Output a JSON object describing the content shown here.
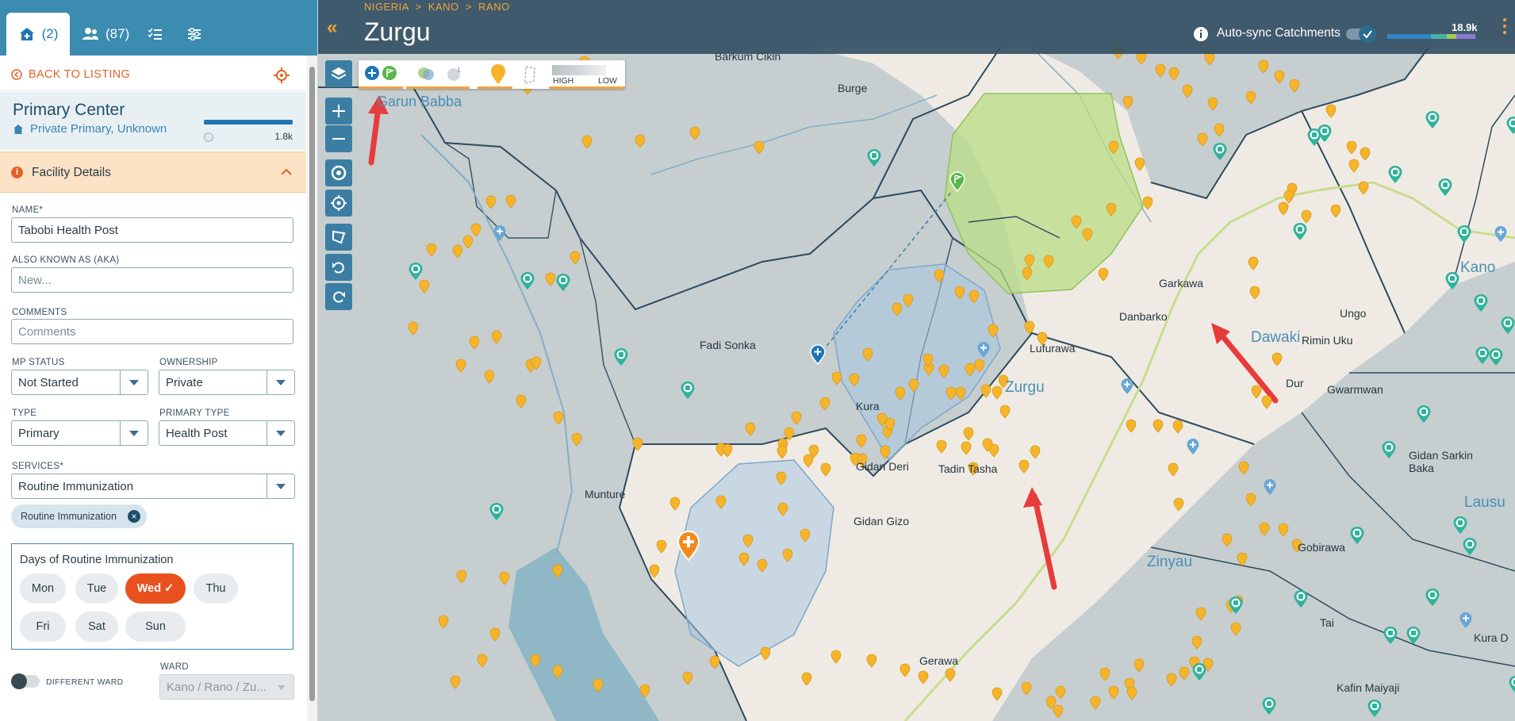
{
  "sidebar": {
    "tabs": [
      {
        "label": "(2)",
        "icon": "home-plus-icon"
      },
      {
        "label": "(87)",
        "icon": "users-icon"
      },
      {
        "label": "",
        "icon": "checklist-icon"
      },
      {
        "label": "",
        "icon": "sliders-icon"
      }
    ],
    "back_label": "BACK TO LISTING",
    "facility": {
      "title": "Primary Center",
      "subtitle": "Private Primary, Unknown",
      "population": "1.8k",
      "population_fraction": 1.0
    },
    "section_title": "Facility Details",
    "fields": {
      "name_label": "NAME*",
      "name_value": "Tabobi Health Post",
      "aka_label": "ALSO KNOWN AS (AKA)",
      "aka_placeholder": "New...",
      "comments_label": "COMMENTS",
      "comments_placeholder": "Comments",
      "mp_status_label": "MP STATUS",
      "mp_status_value": "Not Started",
      "ownership_label": "OWNERSHIP",
      "ownership_value": "Private",
      "type_label": "TYPE",
      "type_value": "Primary",
      "primary_type_label": "PRIMARY TYPE",
      "primary_type_value": "Health Post",
      "services_label": "SERVICES*",
      "services_value": "Routine Immunization",
      "service_chip": "Routine Immunization"
    },
    "days": {
      "title": "Days of Routine Immunization",
      "items": [
        {
          "label": "Mon",
          "selected": false
        },
        {
          "label": "Tue",
          "selected": false
        },
        {
          "label": "Wed ✓",
          "selected": true
        },
        {
          "label": "Thu",
          "selected": false
        },
        {
          "label": "Fri",
          "selected": false
        },
        {
          "label": "Sat",
          "selected": false
        },
        {
          "label": "Sun",
          "selected": false
        }
      ]
    },
    "different_ward_label": "DIFFERENT WARD",
    "ward_label": "WARD",
    "ward_value": "Kano / Rano / Zu..."
  },
  "map": {
    "breadcrumb": "NIGERIA  >  KANO  >  RANO",
    "title": "Zurgu",
    "auto_sync_label": "Auto-sync Catchments",
    "auto_sync_on": true,
    "population_total": "18.9k",
    "legend_high": "HIGH",
    "legend_low": "LOW",
    "places": [
      "Garun Babba",
      "Barkum Cikin",
      "Burge",
      "Fadi Sonka",
      "Kura",
      "Munture",
      "Gidan Deri",
      "Tadin Tasha",
      "Gidan Gizo",
      "Lufurawa",
      "Zurgu",
      "Danbarko",
      "Garkawa",
      "Dawaki",
      "Ungo",
      "Kano",
      "Rimin Uku",
      "Dur",
      "Gwarmwan",
      "Zinyau",
      "Gidan Sarkin Baka",
      "Gobirawa",
      "Tai",
      "Gerawa",
      "Kafin Maiyaji",
      "Lausu",
      "Kura D"
    ],
    "colors": {
      "facility_pin": "#f5b42a",
      "health_post_pin": "#2fb39a",
      "selected_pin": "#f08a1c",
      "catchment_blue": "#aecbe3",
      "catchment_green": "#bfe18a",
      "arrow": "#e83b3b"
    }
  }
}
